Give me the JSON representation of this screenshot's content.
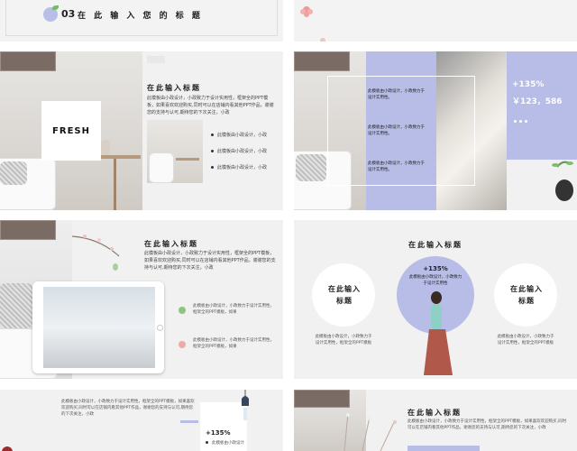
{
  "slide1": {
    "number": "03",
    "title": "在 此 输 入 您 的 标 题"
  },
  "slide2": {
    "fresh": "FRESH",
    "title": "在此输入标题",
    "body": "此模板由小政设计，小政致力于设计实用性，框架全的PPT模板，如果喜欢欢迎购买,同时可以在店铺内看其他PPT作品，谢谢您的支持与认可,期待您的下次关注，小政",
    "bullets": [
      "此模板由小政设计，小政",
      "此模板由小政设计，小政",
      "此模板由小政设计，小政"
    ]
  },
  "slide3": {
    "texts": [
      "此模板由小政设计，小政致力于设计实用性。",
      "此模板由小政设计，小政致力于设计实用性。",
      "此模板由小政设计，小政致力于设计实用性。"
    ],
    "percent": "+135%",
    "amount": "￥123，586"
  },
  "slide4": {
    "title": "在此输入标题",
    "body": "此模板由小政设计，小政致力于设计实用性，框架全的PPT模板，如果喜欢欢迎购买,同时可以在店铺内看其他PPT作品，谢谢您的支持与认可,期待您的下次关注，小政",
    "items": [
      "此模板由小政设计，小政致力于设计实用性，框架全的PPT模板，如果",
      "此模板由小政设计，小政致力于设计实用性，框架全的PPT模板，如果"
    ]
  },
  "slide5": {
    "title": "在此输入标题",
    "left_label": "在此输入标题",
    "right_label": "在此输入标题",
    "center_percent": "+135%",
    "center_text": "此模板由小政设计，小政致力于设计实用性",
    "left_text": "此模板由小政设计，小政致力于设计实用性，框架全的PPT模板",
    "right_text": "此模板由小政设计，小政致力于设计实用性，框架全的PPT模板"
  },
  "slide6": {
    "body": "此模板由小政设计，小政致力于设计实用性，框架全的PPT模板，如果喜欢欢迎购买,同时可以在店铺内看其他PPT作品，谢谢您的支持与认可,期待您的下次关注，小政",
    "percent": "+135%",
    "item": "此模板由小政设计"
  },
  "slide7": {
    "title": "在此输入标题",
    "body": "此模板由小政设计，小政致力于设计实用性，框架全的PPT模板，如果喜欢欢迎购买,同时可以在店铺内看其他PPT作品，谢谢您的支持与认可,期待您的下次关注，小政"
  }
}
